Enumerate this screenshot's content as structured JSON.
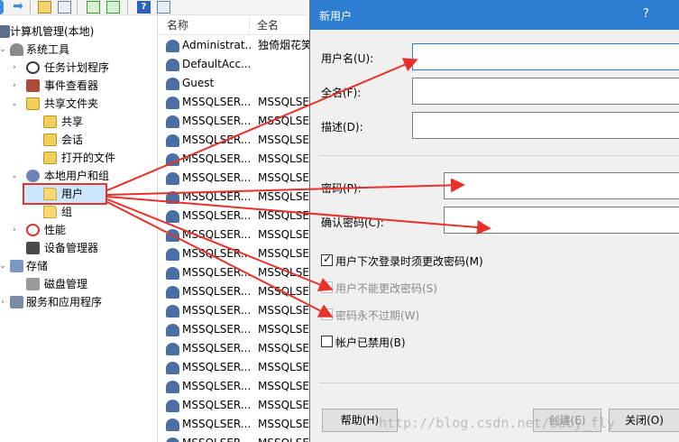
{
  "tree": {
    "root": "计算机管理(本地)",
    "items": [
      "系统工具",
      "任务计划程序",
      "事件查看器",
      "共享文件夹",
      "共享",
      "会话",
      "打开的文件",
      "本地用户和组",
      "用户",
      "组",
      "性能",
      "设备管理器",
      "存储",
      "磁盘管理",
      "服务和应用程序"
    ]
  },
  "list": {
    "col_name": "名称",
    "col_fullname": "全名",
    "rows": [
      {
        "name": "Administrat...",
        "full": "独倚烟花笑"
      },
      {
        "name": "DefaultAcc...",
        "full": ""
      },
      {
        "name": "Guest",
        "full": ""
      },
      {
        "name": "MSSQLSER...",
        "full": "MSSQLSE"
      },
      {
        "name": "MSSQLSER...",
        "full": "MSSQLSE"
      },
      {
        "name": "MSSQLSER...",
        "full": "MSSQLSE"
      },
      {
        "name": "MSSQLSER...",
        "full": "MSSQLSE"
      },
      {
        "name": "MSSQLSER...",
        "full": "MSSQLSE"
      },
      {
        "name": "MSSQLSER...",
        "full": "MSSQLSE"
      },
      {
        "name": "MSSQLSER...",
        "full": "MSSQLSE"
      },
      {
        "name": "MSSQLSER...",
        "full": "MSSQLSE"
      },
      {
        "name": "MSSQLSER...",
        "full": "MSSQLSE"
      },
      {
        "name": "MSSQLSER...",
        "full": "MSSQLSE"
      },
      {
        "name": "MSSQLSER...",
        "full": "MSSQLSE"
      },
      {
        "name": "MSSQLSER...",
        "full": "MSSQLSE"
      },
      {
        "name": "MSSQLSER...",
        "full": "MSSQLSE"
      },
      {
        "name": "MSSQLSER...",
        "full": "MSSQLSE"
      },
      {
        "name": "MSSQLSER...",
        "full": "MSSQLSE"
      },
      {
        "name": "MSSQLSER...",
        "full": "MSSQLSE"
      },
      {
        "name": "MSSQLSER...",
        "full": "MSSQLSE"
      },
      {
        "name": "MSSQLSER...",
        "full": "MSSQLSE"
      },
      {
        "name": "MSSQLSER...",
        "full": "MSSQLSE"
      }
    ]
  },
  "dialog": {
    "title": "新用户",
    "help_glyph": "?",
    "username_label": "用户名(U):",
    "fullname_label": "全名(F):",
    "description_label": "描述(D):",
    "password_label": "密码(P):",
    "confirm_label": "确认密码(C):",
    "cb_must_change": "用户下次登录时须更改密码(M)",
    "cb_cannot_change": "用户不能更改密码(S)",
    "cb_never_expires": "密码永不过期(W)",
    "cb_disabled": "帐户已禁用(B)",
    "btn_help": "帮助(H)",
    "btn_create": "创建(E)",
    "btn_close": "关闭(O)"
  },
  "watermark": "http://blog.csdn.net/baby_fly",
  "colors": {
    "annotation_red": "#e8312b",
    "titlebar_blue": "#2d7dd2",
    "selection_blue": "#cce8ff"
  }
}
